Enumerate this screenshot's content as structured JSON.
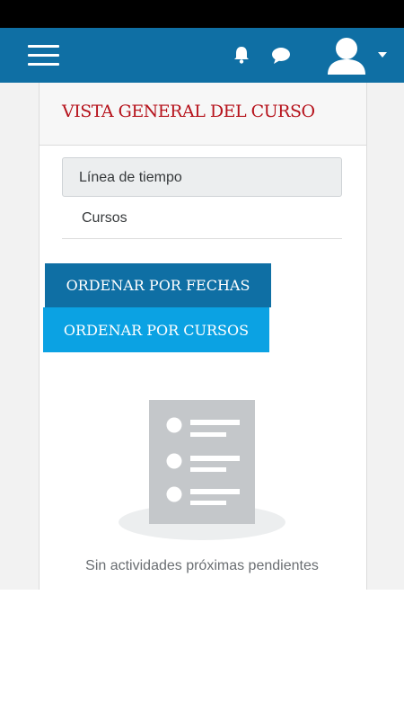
{
  "header": {
    "menu_icon": "hamburger-menu-icon",
    "notifications_icon": "bell-icon",
    "messages_icon": "chat-bubble-icon",
    "user_icon": "user-avatar-icon",
    "user_menu_icon": "caret-down-icon"
  },
  "block": {
    "title": "VISTA GENERAL DEL CURSO",
    "tabs": [
      {
        "label": "Línea de tiempo",
        "active": true
      },
      {
        "label": "Cursos",
        "active": false
      }
    ],
    "sort_buttons": {
      "by_dates": "ORDENAR POR FECHAS",
      "by_courses": "ORDENAR POR CURSOS"
    },
    "empty_state": {
      "icon": "empty-list-document-icon",
      "text": "Sin actividades próximas pendientes"
    }
  },
  "colors": {
    "navbar": "#0f6fa4",
    "title": "#b6121b",
    "button_primary": "#0f6fa4",
    "button_secondary": "#0ba2e3"
  }
}
